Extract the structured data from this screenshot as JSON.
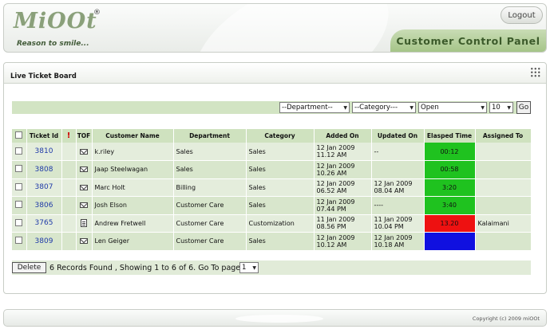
{
  "header": {
    "logo_text": "MiOOt",
    "logo_reg": "®",
    "tagline": "Reason to smile...",
    "logout_label": "Logout",
    "panel_title": "Customer Control Panel"
  },
  "board": {
    "title": "Live Ticket Board",
    "filters": {
      "department": "--Department--",
      "category": "--Category---",
      "status": "Open",
      "page_size": "10",
      "go_label": "Go"
    },
    "columns": [
      "Ticket Id",
      "!",
      "TOF",
      "Customer Name",
      "Department",
      "Category",
      "Added On",
      "Updated On",
      "Elasped Time",
      "Assigned To"
    ],
    "rows": [
      {
        "id": "3810",
        "tof": "mail",
        "customer": "k.riley",
        "department": "Sales",
        "category": "Sales",
        "added": "12 Jan 2009\n11.12 AM",
        "updated": "--",
        "elapsed": "00:12",
        "elapsed_color": "#1fc21f",
        "assigned": ""
      },
      {
        "id": "3808",
        "tof": "mail",
        "customer": "Jaap Steelwagan",
        "department": "Sales",
        "category": "Sales",
        "added": "12 Jan 2009\n10.26 AM",
        "updated": "",
        "elapsed": "00:58",
        "elapsed_color": "#1fc21f",
        "assigned": ""
      },
      {
        "id": "3807",
        "tof": "mail",
        "customer": "Marc Holt",
        "department": "Billing",
        "category": "Sales",
        "added": "12 Jan 2009\n06.52 AM",
        "updated": "12 Jan 2009\n08.04 AM",
        "elapsed": "3:20",
        "elapsed_color": "#1fc21f",
        "assigned": ""
      },
      {
        "id": "3806",
        "tof": "mail",
        "customer": "Josh Elson",
        "department": "Customer Care",
        "category": "Sales",
        "added": "12 Jan 2009\n07.44 PM",
        "updated": "----",
        "elapsed": "3:40",
        "elapsed_color": "#1fc21f",
        "assigned": ""
      },
      {
        "id": "3765",
        "tof": "doc",
        "customer": "Andrew Fretwell",
        "department": "Customer Care",
        "category": "Customization",
        "added": "11 Jan 2009\n08.56 PM",
        "updated": "11 Jan 2009\n10.04 PM",
        "elapsed": "13.20",
        "elapsed_color": "#ee1111",
        "assigned": "Kalaimani"
      },
      {
        "id": "3809",
        "tof": "mail",
        "customer": "Len Geiger",
        "department": "Customer Care",
        "category": "Sales",
        "added": "12 Jan 2009\n10.12 AM",
        "updated": "12 Jan 2009\n10.18 AM",
        "elapsed": "",
        "elapsed_color": "#1010e0",
        "assigned": ""
      }
    ],
    "delete_label": "Delete",
    "records_text": "6 Records Found , Showing 1 to 6 of 6. Go To page",
    "page_value": "1"
  },
  "footer": {
    "copyright": "Copyright (c) 2009 miOOt"
  },
  "icons": {
    "dropdown": "chevron-down-icon",
    "grip": "grip-dots-icon",
    "mail": "mail-icon",
    "doc": "document-icon"
  }
}
